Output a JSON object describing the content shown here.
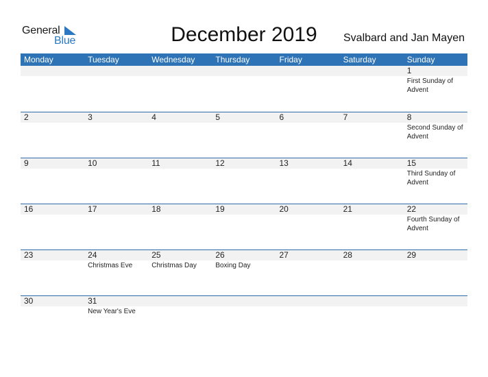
{
  "logo": {
    "line1": "General",
    "line2": "Blue"
  },
  "title": "December 2019",
  "region": "Svalbard and Jan Mayen",
  "colors": {
    "header": "#2e73b5",
    "band": "#f2f2f2",
    "logo_blue": "#2a78c2"
  },
  "weekdays": [
    "Monday",
    "Tuesday",
    "Wednesday",
    "Thursday",
    "Friday",
    "Saturday",
    "Sunday"
  ],
  "weeks": [
    [
      {
        "d": "",
        "e": ""
      },
      {
        "d": "",
        "e": ""
      },
      {
        "d": "",
        "e": ""
      },
      {
        "d": "",
        "e": ""
      },
      {
        "d": "",
        "e": ""
      },
      {
        "d": "",
        "e": ""
      },
      {
        "d": "1",
        "e": "First Sunday of Advent"
      }
    ],
    [
      {
        "d": "2",
        "e": ""
      },
      {
        "d": "3",
        "e": ""
      },
      {
        "d": "4",
        "e": ""
      },
      {
        "d": "5",
        "e": ""
      },
      {
        "d": "6",
        "e": ""
      },
      {
        "d": "7",
        "e": ""
      },
      {
        "d": "8",
        "e": "Second Sunday of Advent"
      }
    ],
    [
      {
        "d": "9",
        "e": ""
      },
      {
        "d": "10",
        "e": ""
      },
      {
        "d": "11",
        "e": ""
      },
      {
        "d": "12",
        "e": ""
      },
      {
        "d": "13",
        "e": ""
      },
      {
        "d": "14",
        "e": ""
      },
      {
        "d": "15",
        "e": "Third Sunday of Advent"
      }
    ],
    [
      {
        "d": "16",
        "e": ""
      },
      {
        "d": "17",
        "e": ""
      },
      {
        "d": "18",
        "e": ""
      },
      {
        "d": "19",
        "e": ""
      },
      {
        "d": "20",
        "e": ""
      },
      {
        "d": "21",
        "e": ""
      },
      {
        "d": "22",
        "e": "Fourth Sunday of Advent"
      }
    ],
    [
      {
        "d": "23",
        "e": ""
      },
      {
        "d": "24",
        "e": "Christmas Eve"
      },
      {
        "d": "25",
        "e": "Christmas Day"
      },
      {
        "d": "26",
        "e": "Boxing Day"
      },
      {
        "d": "27",
        "e": ""
      },
      {
        "d": "28",
        "e": ""
      },
      {
        "d": "29",
        "e": ""
      }
    ],
    [
      {
        "d": "30",
        "e": ""
      },
      {
        "d": "31",
        "e": "New Year's Eve"
      },
      {
        "d": "",
        "e": ""
      },
      {
        "d": "",
        "e": ""
      },
      {
        "d": "",
        "e": ""
      },
      {
        "d": "",
        "e": ""
      },
      {
        "d": "",
        "e": ""
      }
    ]
  ]
}
